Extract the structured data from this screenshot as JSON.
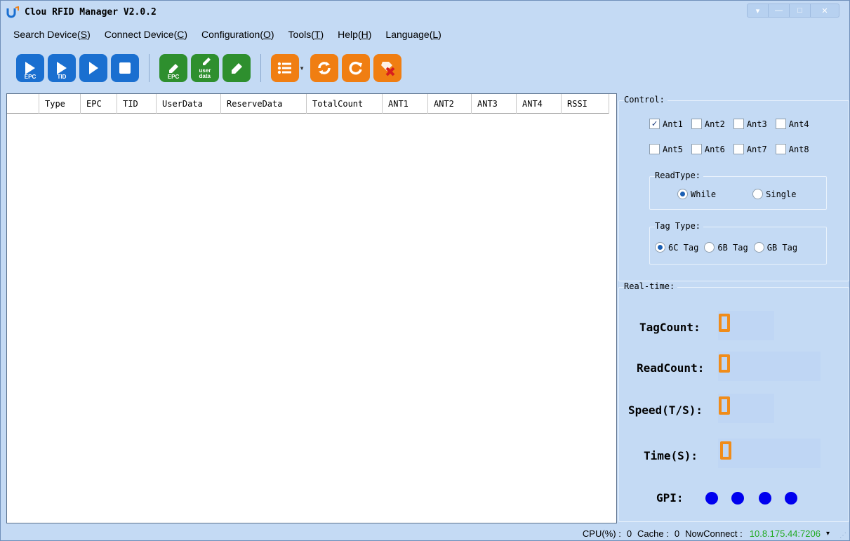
{
  "window": {
    "title": "Clou RFID Manager V2.0.2"
  },
  "window_controls": {
    "dropdown": "▾",
    "minimize": "—",
    "maximize": "□",
    "close": "✕"
  },
  "menu": [
    {
      "label": "Search Device",
      "accel": "S"
    },
    {
      "label": "Connect Device",
      "accel": "C"
    },
    {
      "label": "Configuration",
      "accel": "O"
    },
    {
      "label": "Tools",
      "accel": "T"
    },
    {
      "label": "Help",
      "accel": "H"
    },
    {
      "label": "Language",
      "accel": "L"
    }
  ],
  "toolbar": {
    "read_epc": "EPC",
    "read_tid": "TID",
    "write_epc": "EPC",
    "write_user": "user\ndata"
  },
  "grid": {
    "columns": [
      "Type",
      "EPC",
      "TID",
      "UserData",
      "ReserveData",
      "TotalCount",
      "ANT1",
      "ANT2",
      "ANT3",
      "ANT4",
      "RSSI"
    ]
  },
  "control": {
    "title": "Control:",
    "antennas": [
      {
        "label": "Ant1",
        "checked": true
      },
      {
        "label": "Ant2",
        "checked": false
      },
      {
        "label": "Ant3",
        "checked": false
      },
      {
        "label": "Ant4",
        "checked": false
      },
      {
        "label": "Ant5",
        "checked": false
      },
      {
        "label": "Ant6",
        "checked": false
      },
      {
        "label": "Ant7",
        "checked": false
      },
      {
        "label": "Ant8",
        "checked": false
      }
    ],
    "read_type": {
      "title": "ReadType:",
      "options": [
        "While",
        "Single"
      ],
      "selected": "While"
    },
    "tag_type": {
      "title": "Tag Type:",
      "options": [
        "6C Tag",
        "6B Tag",
        "GB Tag"
      ],
      "selected": "6C Tag"
    }
  },
  "realtime": {
    "title": "Real-time:",
    "tag_count_label": "TagCount:",
    "read_count_label": "ReadCount:",
    "speed_label": "Speed(T/S):",
    "time_label": "Time(S):",
    "gpi_label": "GPI:",
    "tag_count": 0,
    "read_count": 0,
    "speed": 0,
    "time": 0,
    "digit_color": "#f08c1a",
    "gpi_color": "#0000ee"
  },
  "status": {
    "cpu_label": "CPU(%) :",
    "cpu_value": "0",
    "cache_label": "Cache :",
    "cache_value": "0",
    "connect_label": "NowConnect :",
    "connect_value": "10.8.175.44:7206",
    "connect_dropdown": "▾"
  }
}
